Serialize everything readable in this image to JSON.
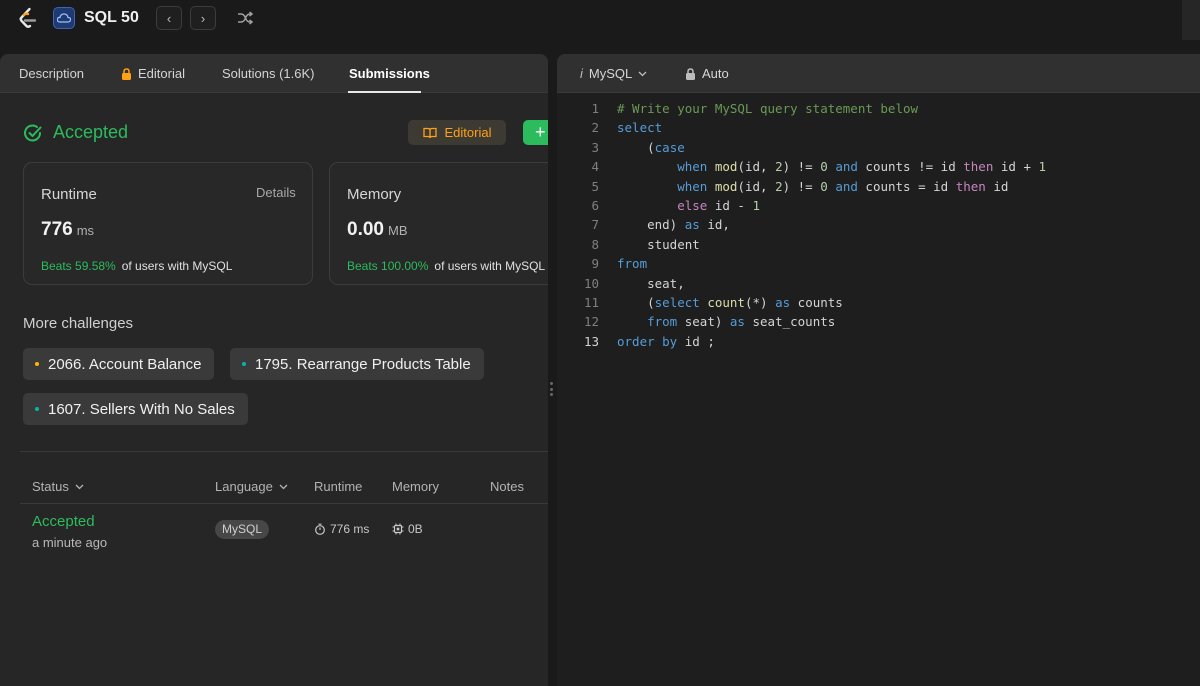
{
  "topbar": {
    "title": "SQL 50",
    "prev_label": "<",
    "next_label": ">"
  },
  "tabs": {
    "description": "Description",
    "editorial": "Editorial",
    "solutions": "Solutions (1.6K)",
    "submissions": "Submissions"
  },
  "result": {
    "status": "Accepted",
    "editorial_button": "Editorial",
    "add_button": "+"
  },
  "runtime_card": {
    "label": "Runtime",
    "details": "Details",
    "value": "776",
    "unit": "ms",
    "beats": "Beats 59.58%",
    "beats_suffix": "of users with MySQL"
  },
  "memory_card": {
    "label": "Memory",
    "value": "0.00",
    "unit": "MB",
    "beats": "Beats 100.00%",
    "beats_suffix": "of users with MySQL"
  },
  "more_challenges": {
    "title": "More challenges",
    "items": [
      {
        "label": "2066. Account Balance",
        "color": "#ffb800"
      },
      {
        "label": "1795. Rearrange Products Table",
        "color": "#00b8a3"
      },
      {
        "label": "1607. Sellers With No Sales",
        "color": "#00b8a3"
      }
    ]
  },
  "table": {
    "headers": {
      "status": "Status",
      "language": "Language",
      "runtime": "Runtime",
      "memory": "Memory",
      "notes": "Notes"
    },
    "rows": [
      {
        "status": "Accepted",
        "time_ago": "a minute ago",
        "language": "MySQL",
        "runtime": "776 ms",
        "memory": "0B"
      }
    ]
  },
  "editor": {
    "language": "MySQL",
    "mode": "Auto",
    "line_numbers": [
      "1",
      "2",
      "3",
      "4",
      "5",
      "6",
      "7",
      "8",
      "9",
      "10",
      "11",
      "12",
      "13"
    ]
  },
  "colors": {
    "accent_green": "#2cbb5d",
    "accent_orange": "#ffa116"
  }
}
